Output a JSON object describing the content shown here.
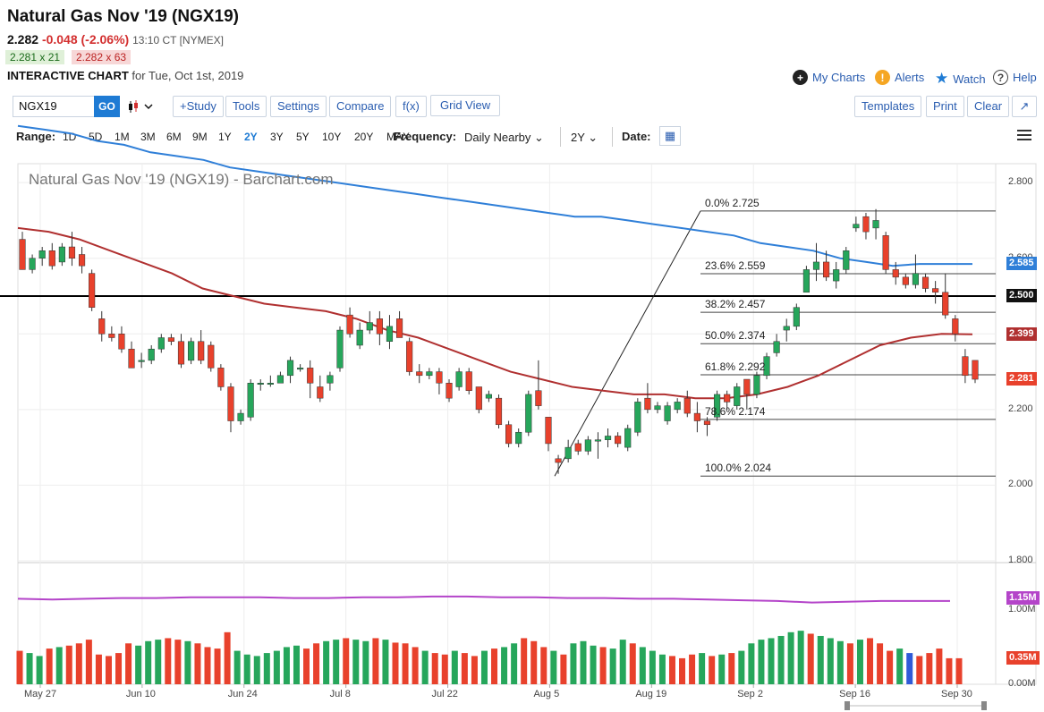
{
  "header": {
    "title": "Natural Gas Nov '19 (NGX19)",
    "last": "2.282",
    "change": "-0.048 (-2.06%)",
    "time": "13:10 CT [NYMEX]",
    "bid": "2.281 x 21",
    "ask": "2.282 x 63",
    "interactive_label": "INTERACTIVE CHART",
    "date_text": "for Tue, Oct 1st, 2019"
  },
  "top_links": {
    "my_charts": "My Charts",
    "alerts": "Alerts",
    "watch": "Watch",
    "help": "Help"
  },
  "toolbar": {
    "symbol": "NGX19",
    "go": "GO",
    "study": "+Study",
    "tools": "Tools",
    "settings": "Settings",
    "compare": "Compare",
    "fx": "f(x)",
    "grid_view": "Grid View",
    "templates": "Templates",
    "print": "Print",
    "clear": "Clear"
  },
  "range_bar": {
    "range_label": "Range:",
    "ranges": [
      "1D",
      "5D",
      "1M",
      "3M",
      "6M",
      "9M",
      "1Y",
      "2Y",
      "3Y",
      "5Y",
      "10Y",
      "20Y",
      "MAX"
    ],
    "active_range": "2Y",
    "frequency_label": "Frequency:",
    "frequency": "Daily Nearby",
    "period": "2Y",
    "date_label": "Date:"
  },
  "colors": {
    "up": "#26a65b",
    "down": "#e8412c",
    "ma200": "#2f7fd8",
    "ma50": "#b03030",
    "volume_ma": "#b444c9",
    "accent": "#1e7bd4"
  },
  "chart_data": {
    "type": "candlestick",
    "title": "Natural Gas Nov '19 (NGX19) - Barchart.com",
    "y_axis": {
      "ylim": [
        1.8,
        2.85
      ],
      "ticks": [
        "2.800",
        "2.600",
        "2.400",
        "2.200",
        "2.000",
        "1.800"
      ]
    },
    "x_ticks": [
      "May 27",
      "Jun 10",
      "Jun 24",
      "Jul 8",
      "Jul 22",
      "Aug 5",
      "Aug 19",
      "Sep 2",
      "Sep 16",
      "Sep 30"
    ],
    "price_labels": [
      {
        "value": "2.585",
        "color": "#2f7fd8"
      },
      {
        "value": "2.500",
        "color": "#111111"
      },
      {
        "value": "2.399",
        "color": "#b03030"
      },
      {
        "value": "2.281",
        "color": "#e8412c"
      }
    ],
    "horizontal_line": 2.5,
    "fibonacci": [
      {
        "label": "0.0% 2.725",
        "value": 2.725
      },
      {
        "label": "23.6% 2.559",
        "value": 2.559
      },
      {
        "label": "38.2% 2.457",
        "value": 2.457
      },
      {
        "label": "50.0% 2.374",
        "value": 2.374
      },
      {
        "label": "61.8% 2.292",
        "value": 2.292
      },
      {
        "label": "78.6% 2.174",
        "value": 2.174
      },
      {
        "label": "100.0% 2.024",
        "value": 2.024
      }
    ],
    "series": [
      {
        "name": "price",
        "candles": [
          [
            2.65,
            2.67,
            2.57,
            2.57
          ],
          [
            2.57,
            2.61,
            2.56,
            2.6
          ],
          [
            2.6,
            2.63,
            2.58,
            2.62
          ],
          [
            2.62,
            2.64,
            2.57,
            2.58
          ],
          [
            2.59,
            2.64,
            2.58,
            2.63
          ],
          [
            2.63,
            2.67,
            2.58,
            2.6
          ],
          [
            2.61,
            2.63,
            2.56,
            2.58
          ],
          [
            2.56,
            2.57,
            2.46,
            2.47
          ],
          [
            2.44,
            2.46,
            2.38,
            2.4
          ],
          [
            2.4,
            2.42,
            2.38,
            2.39
          ],
          [
            2.4,
            2.42,
            2.35,
            2.36
          ],
          [
            2.36,
            2.38,
            2.31,
            2.31
          ],
          [
            2.33,
            2.35,
            2.31,
            2.33
          ],
          [
            2.33,
            2.37,
            2.32,
            2.36
          ],
          [
            2.36,
            2.4,
            2.35,
            2.39
          ],
          [
            2.39,
            2.4,
            2.37,
            2.38
          ],
          [
            2.38,
            2.4,
            2.31,
            2.32
          ],
          [
            2.33,
            2.39,
            2.32,
            2.38
          ],
          [
            2.38,
            2.41,
            2.32,
            2.33
          ],
          [
            2.37,
            2.38,
            2.3,
            2.31
          ],
          [
            2.31,
            2.32,
            2.25,
            2.26
          ],
          [
            2.26,
            2.27,
            2.14,
            2.17
          ],
          [
            2.17,
            2.2,
            2.16,
            2.19
          ],
          [
            2.18,
            2.28,
            2.17,
            2.27
          ],
          [
            2.27,
            2.28,
            2.25,
            2.27
          ],
          [
            2.27,
            2.29,
            2.26,
            2.27
          ],
          [
            2.27,
            2.3,
            2.27,
            2.29
          ],
          [
            2.29,
            2.34,
            2.27,
            2.33
          ],
          [
            2.31,
            2.32,
            2.3,
            2.31
          ],
          [
            2.31,
            2.33,
            2.23,
            2.27
          ],
          [
            2.26,
            2.29,
            2.22,
            2.23
          ],
          [
            2.27,
            2.3,
            2.25,
            2.29
          ],
          [
            2.31,
            2.42,
            2.3,
            2.41
          ],
          [
            2.45,
            2.47,
            2.39,
            2.4
          ],
          [
            2.37,
            2.43,
            2.36,
            2.41
          ],
          [
            2.41,
            2.46,
            2.4,
            2.43
          ],
          [
            2.44,
            2.46,
            2.37,
            2.4
          ],
          [
            2.38,
            2.45,
            2.36,
            2.42
          ],
          [
            2.44,
            2.46,
            2.39,
            2.39
          ],
          [
            2.38,
            2.39,
            2.29,
            2.3
          ],
          [
            2.3,
            2.32,
            2.27,
            2.29
          ],
          [
            2.29,
            2.31,
            2.28,
            2.3
          ],
          [
            2.3,
            2.31,
            2.24,
            2.27
          ],
          [
            2.27,
            2.28,
            2.22,
            2.23
          ],
          [
            2.26,
            2.31,
            2.25,
            2.3
          ],
          [
            2.3,
            2.31,
            2.24,
            2.25
          ],
          [
            2.26,
            2.26,
            2.19,
            2.2
          ],
          [
            2.23,
            2.25,
            2.22,
            2.24
          ],
          [
            2.23,
            2.24,
            2.15,
            2.16
          ],
          [
            2.16,
            2.17,
            2.1,
            2.11
          ],
          [
            2.11,
            2.15,
            2.1,
            2.14
          ],
          [
            2.14,
            2.25,
            2.13,
            2.24
          ],
          [
            2.25,
            2.33,
            2.2,
            2.21
          ],
          [
            2.18,
            2.18,
            2.09,
            2.11
          ],
          [
            2.07,
            2.08,
            2.03,
            2.06
          ],
          [
            2.07,
            2.12,
            2.06,
            2.1
          ],
          [
            2.11,
            2.12,
            2.08,
            2.09
          ],
          [
            2.09,
            2.13,
            2.08,
            2.12
          ],
          [
            2.12,
            2.14,
            2.07,
            2.12
          ],
          [
            2.12,
            2.15,
            2.1,
            2.13
          ],
          [
            2.13,
            2.14,
            2.1,
            2.11
          ],
          [
            2.1,
            2.16,
            2.09,
            2.15
          ],
          [
            2.14,
            2.23,
            2.13,
            2.22
          ],
          [
            2.23,
            2.27,
            2.19,
            2.2
          ],
          [
            2.2,
            2.22,
            2.19,
            2.21
          ],
          [
            2.17,
            2.22,
            2.16,
            2.21
          ],
          [
            2.2,
            2.23,
            2.19,
            2.22
          ],
          [
            2.23,
            2.25,
            2.18,
            2.19
          ],
          [
            2.19,
            2.22,
            2.14,
            2.17
          ],
          [
            2.17,
            2.18,
            2.13,
            2.16
          ],
          [
            2.18,
            2.25,
            2.17,
            2.24
          ],
          [
            2.24,
            2.25,
            2.2,
            2.22
          ],
          [
            2.21,
            2.27,
            2.2,
            2.26
          ],
          [
            2.28,
            2.28,
            2.2,
            2.24
          ],
          [
            2.24,
            2.3,
            2.23,
            2.29
          ],
          [
            2.29,
            2.35,
            2.28,
            2.34
          ],
          [
            2.35,
            2.4,
            2.34,
            2.38
          ],
          [
            2.41,
            2.44,
            2.38,
            2.42
          ],
          [
            2.42,
            2.48,
            2.41,
            2.47
          ],
          [
            2.51,
            2.58,
            2.51,
            2.57
          ],
          [
            2.57,
            2.64,
            2.54,
            2.59
          ],
          [
            2.59,
            2.62,
            2.54,
            2.55
          ],
          [
            2.54,
            2.59,
            2.52,
            2.57
          ],
          [
            2.57,
            2.63,
            2.56,
            2.62
          ],
          [
            2.68,
            2.71,
            2.67,
            2.69
          ],
          [
            2.71,
            2.72,
            2.65,
            2.67
          ],
          [
            2.68,
            2.73,
            2.65,
            2.7
          ],
          [
            2.66,
            2.67,
            2.56,
            2.57
          ],
          [
            2.57,
            2.59,
            2.53,
            2.55
          ],
          [
            2.55,
            2.56,
            2.52,
            2.53
          ],
          [
            2.53,
            2.61,
            2.52,
            2.56
          ],
          [
            2.55,
            2.56,
            2.51,
            2.52
          ],
          [
            2.52,
            2.54,
            2.48,
            2.51
          ],
          [
            2.51,
            2.56,
            2.44,
            2.45
          ],
          [
            2.44,
            2.45,
            2.38,
            2.4
          ],
          [
            2.34,
            2.36,
            2.27,
            2.29
          ],
          [
            2.33,
            2.33,
            2.27,
            2.28
          ]
        ]
      },
      {
        "name": "moving-average-200",
        "values": [
          2.95,
          2.94,
          2.93,
          2.91,
          2.9,
          2.88,
          2.87,
          2.86,
          2.84,
          2.83,
          2.82,
          2.81,
          2.8,
          2.79,
          2.78,
          2.77,
          2.76,
          2.75,
          2.74,
          2.73,
          2.72,
          2.71,
          2.71,
          2.7,
          2.69,
          2.68,
          2.67,
          2.66,
          2.64,
          2.63,
          2.62,
          2.6,
          2.59,
          2.58,
          2.585,
          2.585,
          2.585
        ]
      },
      {
        "name": "moving-average-50",
        "values": [
          2.68,
          2.67,
          2.65,
          2.62,
          2.59,
          2.56,
          2.52,
          2.5,
          2.48,
          2.47,
          2.46,
          2.44,
          2.41,
          2.39,
          2.36,
          2.33,
          2.3,
          2.28,
          2.26,
          2.25,
          2.24,
          2.24,
          2.23,
          2.23,
          2.24,
          2.26,
          2.29,
          2.33,
          2.37,
          2.39,
          2.4,
          2.399
        ]
      },
      {
        "name": "volume",
        "label": "0.35M",
        "values": [
          0.45,
          0.42,
          0.38,
          0.48,
          0.5,
          0.52,
          0.55,
          0.6,
          0.4,
          0.38,
          0.42,
          0.55,
          0.52,
          0.58,
          0.6,
          0.62,
          0.6,
          0.58,
          0.55,
          0.5,
          0.48,
          0.7,
          0.45,
          0.4,
          0.38,
          0.42,
          0.45,
          0.5,
          0.52,
          0.48,
          0.55,
          0.58,
          0.6,
          0.62,
          0.6,
          0.58,
          0.62,
          0.6,
          0.56,
          0.55,
          0.5,
          0.45,
          0.42,
          0.4,
          0.45,
          0.42,
          0.38,
          0.45,
          0.48,
          0.5,
          0.55,
          0.62,
          0.58,
          0.5,
          0.45,
          0.4,
          0.55,
          0.58,
          0.52,
          0.5,
          0.48,
          0.6,
          0.55,
          0.5,
          0.45,
          0.4,
          0.38,
          0.35,
          0.4,
          0.42,
          0.38,
          0.4,
          0.42,
          0.45,
          0.55,
          0.6,
          0.62,
          0.65,
          0.7,
          0.72,
          0.68,
          0.65,
          0.62,
          0.58,
          0.55,
          0.6,
          0.62,
          0.55,
          0.45,
          0.48,
          0.42,
          0.38,
          0.42,
          0.48,
          0.35,
          0.35
        ]
      },
      {
        "name": "volume-average",
        "label": "1.15M",
        "values": [
          1.15,
          1.14,
          1.15,
          1.16,
          1.16,
          1.17,
          1.17,
          1.17,
          1.16,
          1.16,
          1.17,
          1.17,
          1.18,
          1.18,
          1.17,
          1.17,
          1.16,
          1.16,
          1.15,
          1.15,
          1.14,
          1.13,
          1.12,
          1.1,
          1.11,
          1.12,
          1.12,
          1.12
        ]
      }
    ]
  }
}
